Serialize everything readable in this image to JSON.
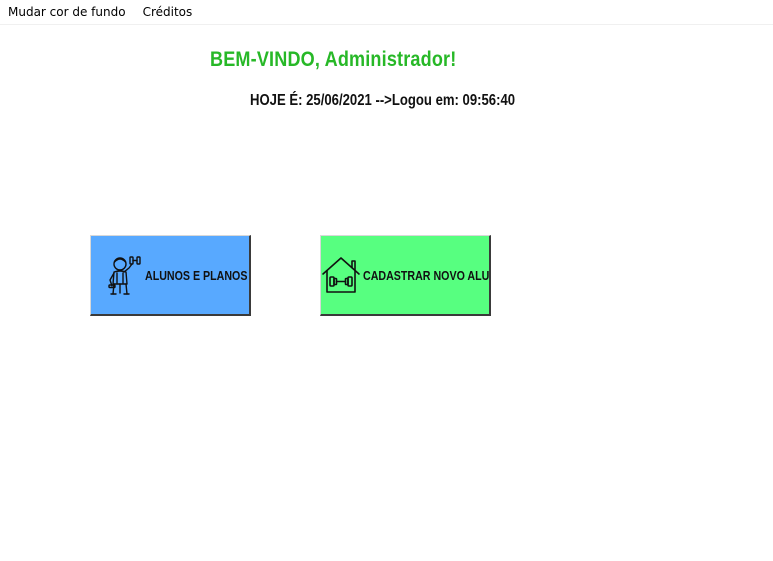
{
  "menubar": {
    "items": [
      {
        "label": "Mudar cor de fundo"
      },
      {
        "label": "Créditos"
      }
    ]
  },
  "header": {
    "welcome": "BEM-VINDO, Administrador!",
    "dateline": "HOJE É: 25/06/2021 -->Logou em: 09:56:40"
  },
  "buttons": {
    "alunos": {
      "label": "ALUNOS E PLANOS",
      "icon": "person-with-dumbbell-icon",
      "color": "#58a9ff"
    },
    "cadastrar": {
      "label": "CADASTRAR NOVO ALUNO",
      "icon": "gym-house-icon",
      "color": "#57ff80"
    }
  },
  "colors": {
    "welcome_text": "#27b827",
    "background": "#ffffff"
  }
}
